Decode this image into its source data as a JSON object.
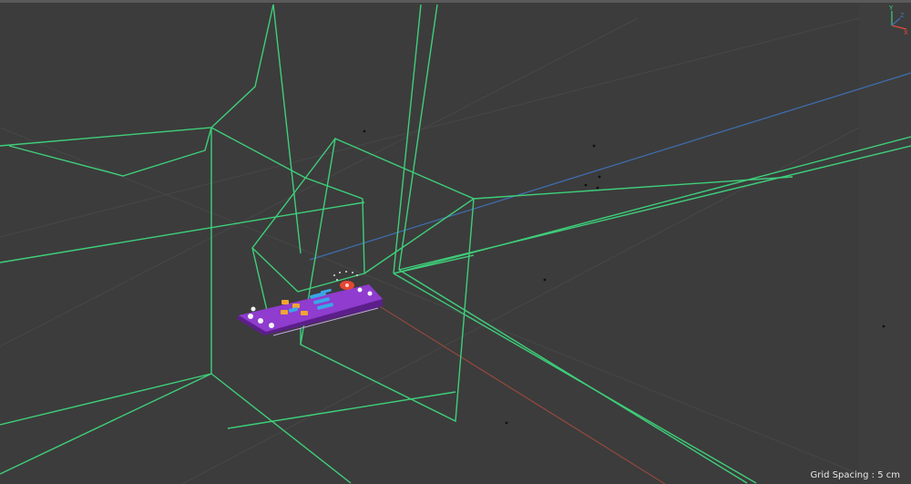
{
  "viewport": {
    "grid_spacing_text": "Grid Spacing : 5 cm",
    "axis_labels": {
      "y": "Y",
      "x": "X",
      "z": "Z"
    }
  },
  "colors": {
    "background": "#3c3c3c",
    "wireframe": "#3ecf7a",
    "axis_x": "#a34a3c",
    "axis_z": "#3f6fb2",
    "object_body": "#7b2fb6",
    "object_top": "#8f3ccf",
    "key_blue": "#3aa6e8",
    "key_orange": "#f2a431",
    "key_red": "#e64632",
    "key_white": "#f4f4f4"
  },
  "scene": {
    "object_name": "remote-control-model",
    "icons": [
      "axis-gizmo-icon"
    ]
  }
}
